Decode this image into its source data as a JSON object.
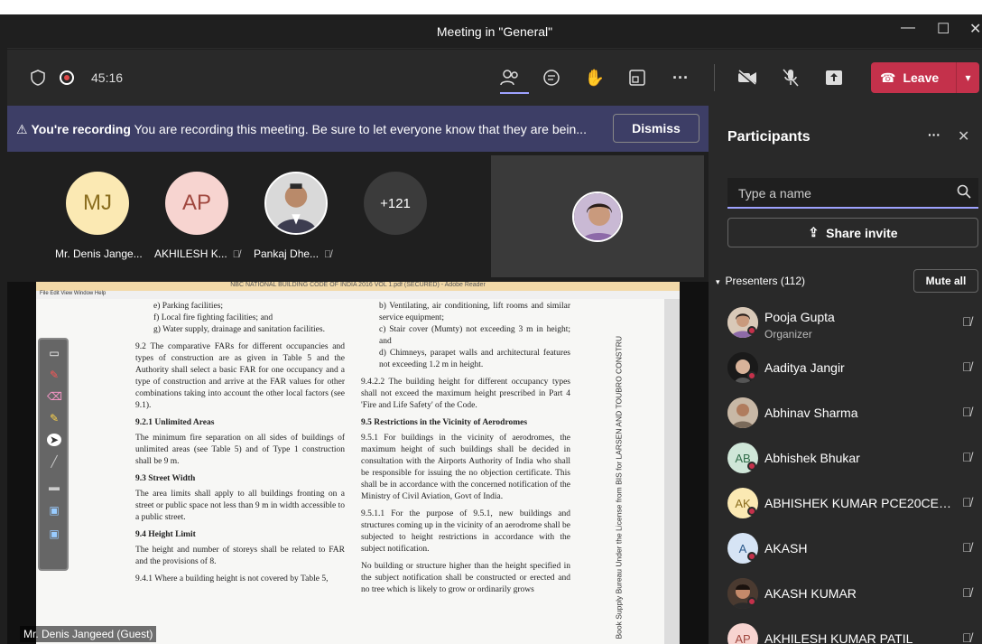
{
  "window": {
    "title": "Meeting in \"General\""
  },
  "toolbar": {
    "timer": "45:16",
    "leave_label": "Leave"
  },
  "banner": {
    "bold": "You're recording",
    "text": "You are recording this meeting. Be sure to let everyone know that they are bein...",
    "dismiss": "Dismiss"
  },
  "gallery": {
    "tiles": [
      {
        "initials": "MJ",
        "name": "Mr. Denis Jange...",
        "color": "#fbe9b3"
      },
      {
        "initials": "AP",
        "name": "AKHILESH K...",
        "color": "#f7d4d0"
      },
      {
        "initials": "",
        "name": "Pankaj Dhe...",
        "color": "#e8e8e8"
      },
      {
        "initials": "+121",
        "name": "",
        "color": "#3b3b3b"
      }
    ]
  },
  "share": {
    "pdf_title": "NBC NATIONAL BUILDING CODE OF INDIA 2016 VOL 1.pdf (SECURED) - Adobe Reader",
    "pdf_menu": "File  Edit  View  Window  Help",
    "presenter": "Mr. Denis Jangeed (Guest)",
    "col1": {
      "list": [
        "e) Parking facilities;",
        "f) Local fire fighting facilities; and",
        "g) Water supply, drainage and sanitation facilities."
      ],
      "p92": "9.2 The comparative FARs for different occupancies and types of construction are as given in Table 5 and the Authority shall select a basic FAR for one occupancy and a type of construction and arrive at the FAR values for other combinations taking into account the other local factors (see 9.1).",
      "h921": "9.2.1 Unlimited Areas",
      "p921": "The minimum fire separation on all sides of buildings of unlimited areas (see Table 5) and of Type 1 construction shall be 9 m.",
      "h93": "9.3 Street Width",
      "p93": "The area limits shall apply to all buildings fronting on a street or public space not less than 9 m in width accessible to a public street.",
      "h94": "9.4 Height Limit",
      "p94": "The height and number of storeys shall be related to FAR and the provisions of 8.",
      "p941": "9.4.1 Where a building height is not covered by Table 5,"
    },
    "col2": {
      "list": [
        "b) Ventilating, air conditioning, lift rooms and similar service equipment;",
        "c) Stair cover (Mumty) not exceeding 3 m in height; and",
        "d) Chimneys, parapet walls and architectural features not exceeding 1.2 m in height."
      ],
      "p9422": "9.4.2.2 The building height for different occupancy types shall not exceed the maximum height prescribed in Part 4 'Fire and Life Safety' of the Code.",
      "h95": "9.5 Restrictions in the Vicinity of Aerodromes",
      "p951": "9.5.1 For buildings in the vicinity of aerodromes, the maximum height of such buildings shall be decided in consultation with the Airports Authority of India who shall be responsible for issuing the no objection certificate. This shall be in accordance with the concerned notification of the Ministry of Civil Aviation, Govt of India.",
      "p9511": "9.5.1.1 For the purpose of 9.5.1, new buildings and structures coming up in the vicinity of an aerodrome shall be subjected to height restrictions in accordance with the subject notification.",
      "p_last": "No building or structure higher than the height specified in the subject notification shall be constructed or erected and no tree which is likely to grow or ordinarily grows"
    },
    "vertical_text": "Book Supply Bureau Under the License from BIS for LARSEN AND TOUBRO CONSTRU"
  },
  "panel": {
    "title": "Participants",
    "search_placeholder": "Type a name",
    "share_invite": "Share invite",
    "presenters_label": "Presenters (112)",
    "mute_all": "Mute all",
    "participants": [
      {
        "name": "Pooja Gupta",
        "role": "Organizer",
        "initials": "",
        "color": "#d8c7b5"
      },
      {
        "name": "Aaditya Jangir",
        "role": "",
        "initials": "",
        "color": "#6b4b3e"
      },
      {
        "name": "Abhinav Sharma",
        "role": "",
        "initials": "",
        "color": "#b59a82"
      },
      {
        "name": "Abhishek Bhukar",
        "role": "",
        "initials": "AB",
        "color": "#cfe6d8"
      },
      {
        "name": "ABHISHEK KUMAR PCE20CE800 ...",
        "role": "",
        "initials": "AK",
        "color": "#fbe9b3"
      },
      {
        "name": "AKASH",
        "role": "",
        "initials": "A",
        "color": "#d6e4f5"
      },
      {
        "name": "AKASH KUMAR",
        "role": "",
        "initials": "",
        "color": "#5a4236"
      },
      {
        "name": "AKHILESH KUMAR PATIL",
        "role": "",
        "initials": "AP",
        "color": "#f7d4d0"
      }
    ]
  }
}
